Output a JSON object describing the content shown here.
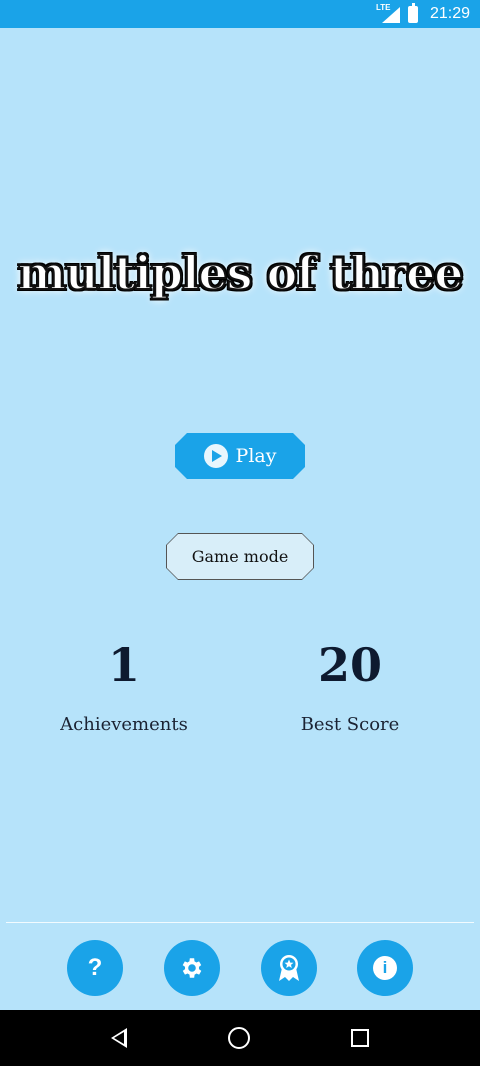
{
  "status": {
    "network": "LTE",
    "time": "21:29"
  },
  "title": "multiples of three",
  "play": {
    "label": "Play"
  },
  "game_mode": {
    "label": "Game mode"
  },
  "stats": {
    "achievements": {
      "value": "1",
      "label": "Achievements"
    },
    "best_score": {
      "value": "20",
      "label": "Best Score"
    }
  },
  "toolbar": {
    "help_glyph": "?",
    "settings_icon": "gear-icon",
    "achievements_icon": "award-icon",
    "info_glyph": "i"
  },
  "colors": {
    "background": "#b6e3fa",
    "accent": "#1aa3e8",
    "text": "#0e1a2f"
  }
}
